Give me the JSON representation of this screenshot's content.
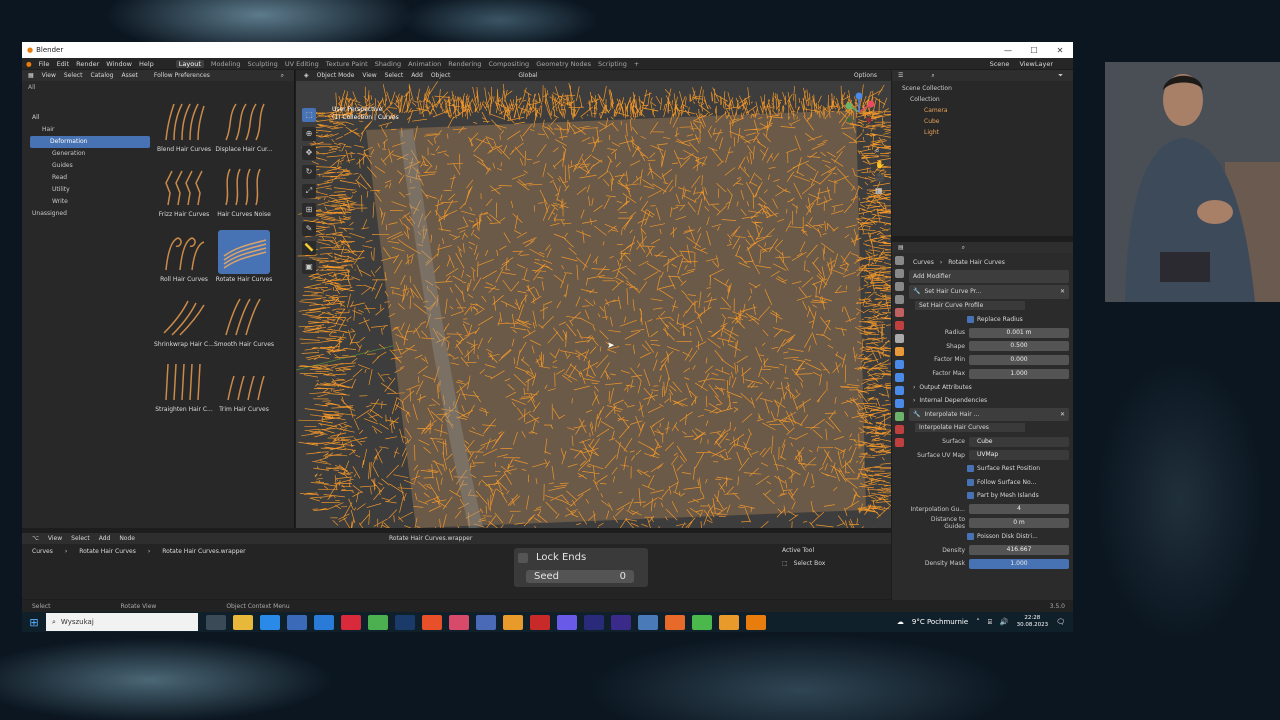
{
  "window": {
    "title": "Blender",
    "min": "—",
    "max": "☐",
    "close": "✕"
  },
  "menubar": {
    "menus": [
      "File",
      "Edit",
      "Render",
      "Window",
      "Help"
    ],
    "workspaces": [
      "Layout",
      "Modeling",
      "Sculpting",
      "UV Editing",
      "Texture Paint",
      "Shading",
      "Animation",
      "Rendering",
      "Compositing",
      "Geometry Nodes",
      "Scripting"
    ],
    "add_tab": "+",
    "scene": "Scene",
    "view_layer": "ViewLayer"
  },
  "asset_browser": {
    "header": [
      "View",
      "Select",
      "Catalog",
      "Asset"
    ],
    "library": "Follow Preferences",
    "filter": "All",
    "tree": [
      {
        "label": "All"
      },
      {
        "label": "Hair"
      },
      {
        "label": "Deformation",
        "selected": true
      },
      {
        "label": "Generation"
      },
      {
        "label": "Guides"
      },
      {
        "label": "Read"
      },
      {
        "label": "Utility"
      },
      {
        "label": "Write"
      },
      {
        "label": "Unassigned"
      }
    ],
    "assets": [
      {
        "label": "Blend Hair Curves"
      },
      {
        "label": "Displace Hair Cur..."
      },
      {
        "label": "Frizz Hair Curves"
      },
      {
        "label": "Hair Curves Noise"
      },
      {
        "label": "Roll Hair Curves"
      },
      {
        "label": "Rotate Hair Curves",
        "selected": true
      },
      {
        "label": "Shrinkwrap Hair C..."
      },
      {
        "label": "Smooth Hair Curves"
      },
      {
        "label": "Straighten Hair C..."
      },
      {
        "label": "Trim Hair Curves"
      }
    ]
  },
  "viewport": {
    "mode": "Object Mode",
    "header": [
      "View",
      "Select",
      "Add",
      "Object"
    ],
    "orientation": "Global",
    "options": "Options",
    "info_line1": "User Perspective",
    "info_line2": "(1) Collection | Curves",
    "hair_color": "#f0962a"
  },
  "outliner": {
    "rows": [
      "Scene Collection",
      "Collection",
      "Camera",
      "Cube",
      "Light"
    ]
  },
  "properties": {
    "breadcrumb_obj": "Curves",
    "breadcrumb_mod": "Rotate Hair Curves",
    "add_modifier": "Add Modifier",
    "mod1_name": "Set Hair Curve Pr...",
    "mod1_node": "Set Hair Curve Profile",
    "replace_radius": "Replace Radius",
    "fields1": [
      {
        "k": "Radius",
        "v": "0.001 m"
      },
      {
        "k": "Shape",
        "v": "0.500"
      },
      {
        "k": "Factor Min",
        "v": "0.000"
      },
      {
        "k": "Factor Max",
        "v": "1.000"
      }
    ],
    "output_attributes": "Output Attributes",
    "internal_dependencies": "Internal Dependencies",
    "mod2_name": "Interpolate Hair ...",
    "mod2_node": "Interpolate Hair Curves",
    "surface_label": "Surface",
    "surface_value": "Cube",
    "uvmap_label": "Surface UV Map",
    "uvmap_value": "UVMap",
    "checks": [
      "Surface Rest Position",
      "Follow Surface No...",
      "Part by Mesh Islands"
    ],
    "interp_label": "Interpolation Gu...",
    "interp_value": "4",
    "dist_label": "Distance to Guides",
    "dist_value": "0 m",
    "poisson": "Poisson Disk Distri...",
    "density_label": "Density",
    "density_value": "416.667",
    "mask_label": "Density Mask",
    "mask_value": "1.000"
  },
  "node_editor": {
    "header": [
      "View",
      "Select",
      "Add",
      "Node"
    ],
    "group_name": "Rotate Hair Curves.wrapper",
    "breadcrumb": [
      "Curves",
      "Rotate Hair Curves",
      "Rotate Hair Curves.wrapper"
    ],
    "lock_ends": "Lock Ends",
    "seed_label": "Seed",
    "seed_value": "0",
    "active_tool": "Active Tool",
    "select_box": "Select Box"
  },
  "statusbar": {
    "select": "Select",
    "rotate": "Rotate View",
    "context": "Object Context Menu",
    "version": "3.5.0"
  },
  "taskbar": {
    "search_placeholder": "Wyszukaj",
    "weather": "9°C Pochmurnie",
    "time": "22:28",
    "date": "30.08.2023"
  }
}
